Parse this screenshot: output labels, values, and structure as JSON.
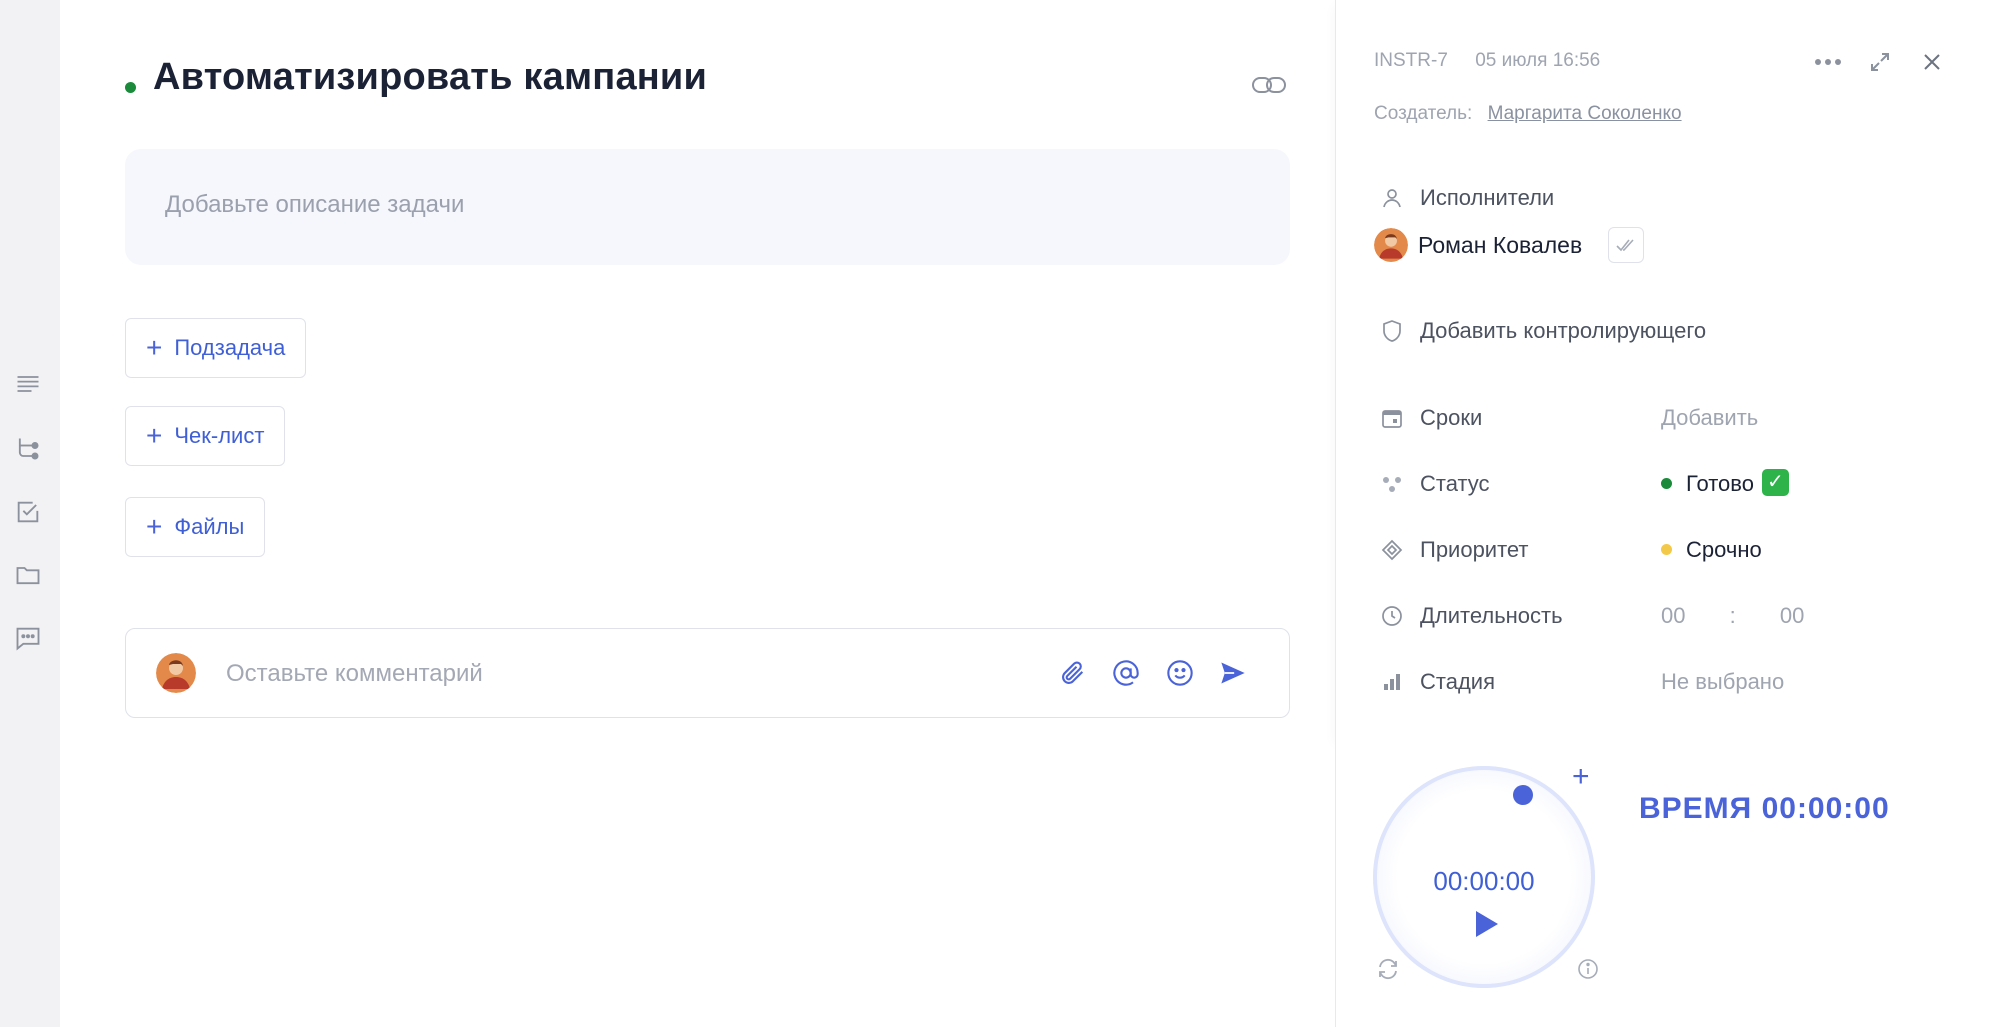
{
  "task": {
    "title": "Автоматизировать кампании",
    "description_placeholder": "Добавьте описание задачи",
    "buttons": {
      "subtask": "Подзадача",
      "checklist": "Чек-лист",
      "files": "Файлы"
    },
    "comment_placeholder": "Оставьте комментарий",
    "status_color": "#1b8a3b"
  },
  "panel": {
    "task_id": "INSTR-7",
    "created_at": "05 июля 16:56",
    "creator_label": "Создатель:",
    "creator_name": "Маргарита Соколенко",
    "assignees_label": "Исполнители",
    "assignee_name": "Роман Ковалев",
    "add_controller": "Добавить контролирующего",
    "fields": {
      "deadline_label": "Сроки",
      "deadline_value": "Добавить",
      "status_label": "Статус",
      "status_value": "Готово",
      "priority_label": "Приоритет",
      "priority_value": "Срочно",
      "duration_label": "Длительность",
      "duration_hours": "00",
      "duration_sep": ":",
      "duration_minutes": "00",
      "stage_label": "Стадия",
      "stage_value": "Не выбрано"
    },
    "colors": {
      "status_dot": "#1b8a3b",
      "priority_dot": "#f3c94a",
      "accent": "#4a63d8"
    }
  },
  "timer": {
    "display": "00:00:00",
    "label": "ВРЕМЯ 00:00:00"
  },
  "icons": {
    "rail": [
      "lines-icon",
      "subtasks-icon",
      "checkbox-icon",
      "folder-icon",
      "chat-icon"
    ]
  }
}
